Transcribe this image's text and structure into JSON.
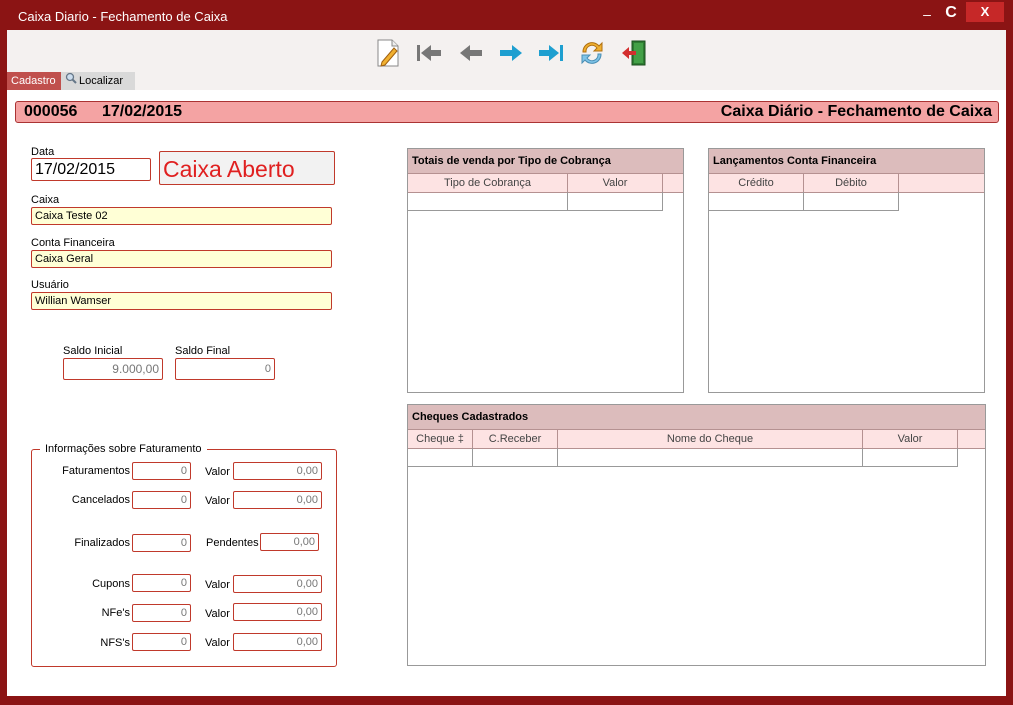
{
  "window": {
    "title": "Caixa Diario - Fechamento de Caixa",
    "min": "–",
    "restore": "C",
    "close": "X"
  },
  "tabs": {
    "cadastro": "Cadastro",
    "localizar": "Localizar"
  },
  "header": {
    "number": "000056",
    "date": "17/02/2015",
    "title": "Caixa Diário - Fechamento de Caixa"
  },
  "form": {
    "data_label": "Data",
    "data_value": "17/02/2015",
    "status": "Caixa Aberto",
    "caixa_label": "Caixa",
    "caixa_value": "Caixa Teste 02",
    "conta_label": "Conta Financeira",
    "conta_value": "Caixa Geral",
    "usuario_label": "Usuário",
    "usuario_value": "Willian Wamser",
    "saldo_inicial_label": "Saldo Inicial",
    "saldo_inicial_value": "9.000,00",
    "saldo_final_label": "Saldo Final",
    "saldo_final_value": "0"
  },
  "faturamento": {
    "legend": "Informações sobre Faturamento",
    "rows": [
      {
        "label": "Faturamentos",
        "count": "0",
        "vlabel": "Valor",
        "value": "0,00"
      },
      {
        "label": "Cancelados",
        "count": "0",
        "vlabel": "Valor",
        "value": "0,00"
      },
      {
        "label": "Finalizados",
        "count": "0",
        "vlabel": "Pendentes",
        "value": "0,00"
      },
      {
        "label": "Cupons",
        "count": "0",
        "vlabel": "Valor",
        "value": "0,00"
      },
      {
        "label": "NFe's",
        "count": "0",
        "vlabel": "Valor",
        "value": "0,00"
      },
      {
        "label": "NFS's",
        "count": "0",
        "vlabel": "Valor",
        "value": "0,00"
      }
    ]
  },
  "grids": {
    "totais": {
      "title": "Totais de venda por Tipo de Cobrança",
      "cols": [
        "Tipo de Cobrança",
        "Valor"
      ]
    },
    "lancamentos": {
      "title": "Lançamentos Conta Financeira",
      "cols": [
        "Crédito",
        "Débito"
      ]
    },
    "cheques": {
      "title": "Cheques Cadastrados",
      "cols": [
        "Cheque ‡",
        "C.Receber",
        "Nome do Cheque",
        "Valor"
      ]
    }
  },
  "toolbar_icons": [
    "new-document-icon",
    "first-record-icon",
    "previous-record-icon",
    "next-record-icon",
    "last-record-icon",
    "refresh-icon",
    "exit-icon"
  ],
  "colors": {
    "frame": "#8b1414",
    "accent": "#c0504d",
    "header": "#f4a3a3",
    "input_yellow": "#ffffd6"
  }
}
